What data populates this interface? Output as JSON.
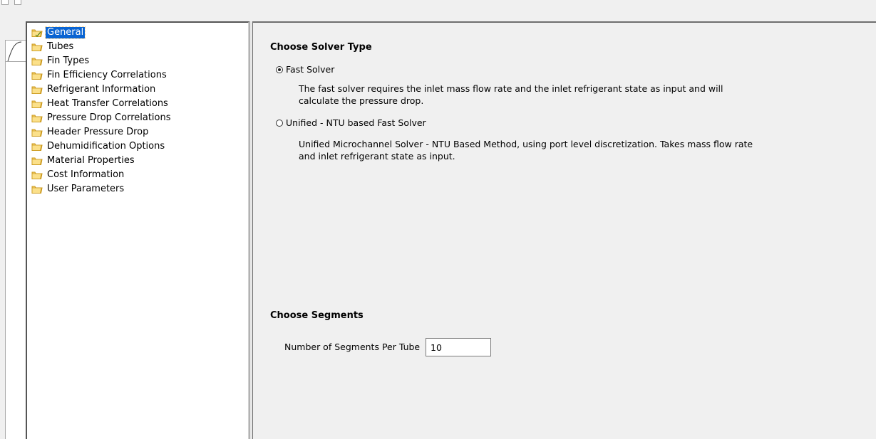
{
  "tree": {
    "items": [
      {
        "label": "General",
        "selected": true
      },
      {
        "label": "Tubes"
      },
      {
        "label": "Fin Types"
      },
      {
        "label": "Fin Efficiency Correlations"
      },
      {
        "label": "Refrigerant Information"
      },
      {
        "label": "Heat Transfer Correlations"
      },
      {
        "label": "Pressure Drop Correlations"
      },
      {
        "label": "Header Pressure Drop"
      },
      {
        "label": "Dehumidification Options"
      },
      {
        "label": "Material Properties"
      },
      {
        "label": "Cost Information"
      },
      {
        "label": "User Parameters"
      }
    ]
  },
  "solver": {
    "title": "Choose Solver Type",
    "fast_label": "Fast Solver",
    "fast_checked": true,
    "fast_desc_1": "The fast solver requires the inlet  mass flow rate and the inlet refrigerant state as input and will",
    "fast_desc_2": "calculate the pressure drop.",
    "unified_label": "Unified - NTU based Fast Solver",
    "unified_checked": false,
    "unified_desc_1": "Unified Microchannel Solver - NTU Based Method, using port level discretization. Takes mass flow rate",
    "unified_desc_2": "and inlet refrigerant state as input."
  },
  "segments": {
    "title": "Choose Segments",
    "label": "Number of Segments Per Tube",
    "value": "10"
  },
  "colors": {
    "selection": "#0a64d2",
    "folder": "#f5c542"
  }
}
